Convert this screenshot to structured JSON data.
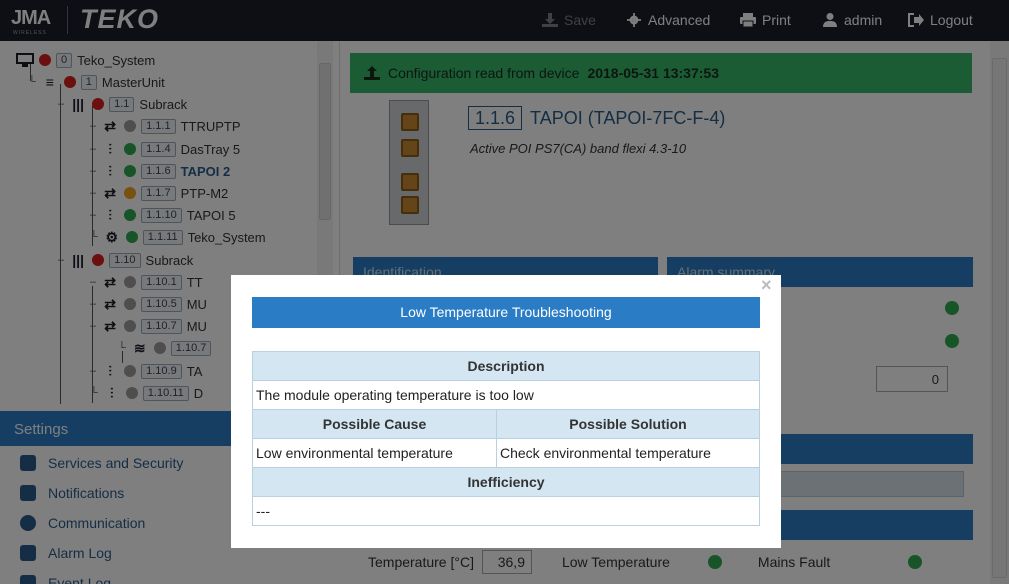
{
  "topbar": {
    "logo_primary": "JMA",
    "logo_sub": "WIRELESS",
    "logo_secondary": "TEKO",
    "save_label": "Save",
    "advanced_label": "Advanced",
    "print_label": "Print",
    "user_label": "admin",
    "logout_label": "Logout"
  },
  "tree": {
    "items": [
      {
        "badge": "0",
        "label": "Teko_System",
        "status": "red"
      },
      {
        "badge": "1",
        "label": "MasterUnit",
        "status": "red"
      },
      {
        "badge": "1.1",
        "label": "Subrack",
        "status": "red"
      },
      {
        "badge": "1.1.1",
        "label": "TTRUPTP",
        "status": "gray"
      },
      {
        "badge": "1.1.4",
        "label": "DasTray 5",
        "status": "green"
      },
      {
        "badge": "1.1.6",
        "label": "TAPOI 2",
        "status": "green"
      },
      {
        "badge": "1.1.7",
        "label": "PTP-M2",
        "status": "orange"
      },
      {
        "badge": "1.1.10",
        "label": "TAPOI 5",
        "status": "green"
      },
      {
        "badge": "1.1.11",
        "label": "Teko_System",
        "status": "green"
      },
      {
        "badge": "1.10",
        "label": "Subrack",
        "status": "red"
      },
      {
        "badge": "1.10.1",
        "label": "TT",
        "status": "gray"
      },
      {
        "badge": "1.10.5",
        "label": "MU",
        "status": "gray"
      },
      {
        "badge": "1.10.7",
        "label": "MU",
        "status": "gray"
      },
      {
        "badge": "1.10.7",
        "label": "",
        "status": "gray"
      },
      {
        "badge": "1.10.9",
        "label": "TA",
        "status": "gray"
      },
      {
        "badge": "1.10.11",
        "label": "D",
        "status": "gray"
      }
    ]
  },
  "settings": {
    "heading": "Settings",
    "items": [
      "Services and Security",
      "Notifications",
      "Communication",
      "Alarm Log",
      "Event Log"
    ]
  },
  "main": {
    "alert_text": "Configuration read from device",
    "alert_date": "2018-05-31 13:37:53",
    "device_badge": "1.1.6",
    "device_name": "TAPOI (TAPOI-7FC-F-4)",
    "device_desc": "Active POI PS7(CA) band flexi 4.3-10",
    "identification_heading": "Identification",
    "alarm_summary_heading": "Alarm summary",
    "alarm_count": "0",
    "temperature_label": "Temperature [°C]",
    "temperature_value": "36,9",
    "low_temp_label": "Low Temperature",
    "mains_fault_label": "Mains Fault"
  },
  "modal": {
    "title": "Low Temperature Troubleshooting",
    "description_header": "Description",
    "description": "The module operating temperature is too low",
    "cause_header": "Possible Cause",
    "solution_header": "Possible Solution",
    "cause": "Low environmental temperature",
    "solution": "Check environmental temperature",
    "inefficiency_header": "Inefficiency",
    "inefficiency": "---",
    "close_symbol": "×"
  },
  "colors": {
    "accent": "#2a7dc5",
    "topbar": "#1b1f2b",
    "success": "#36b86b",
    "status_red": "#d81f1f",
    "status_green": "#2fa84f",
    "status_orange": "#f0a020",
    "status_gray": "#9c9c9c"
  }
}
